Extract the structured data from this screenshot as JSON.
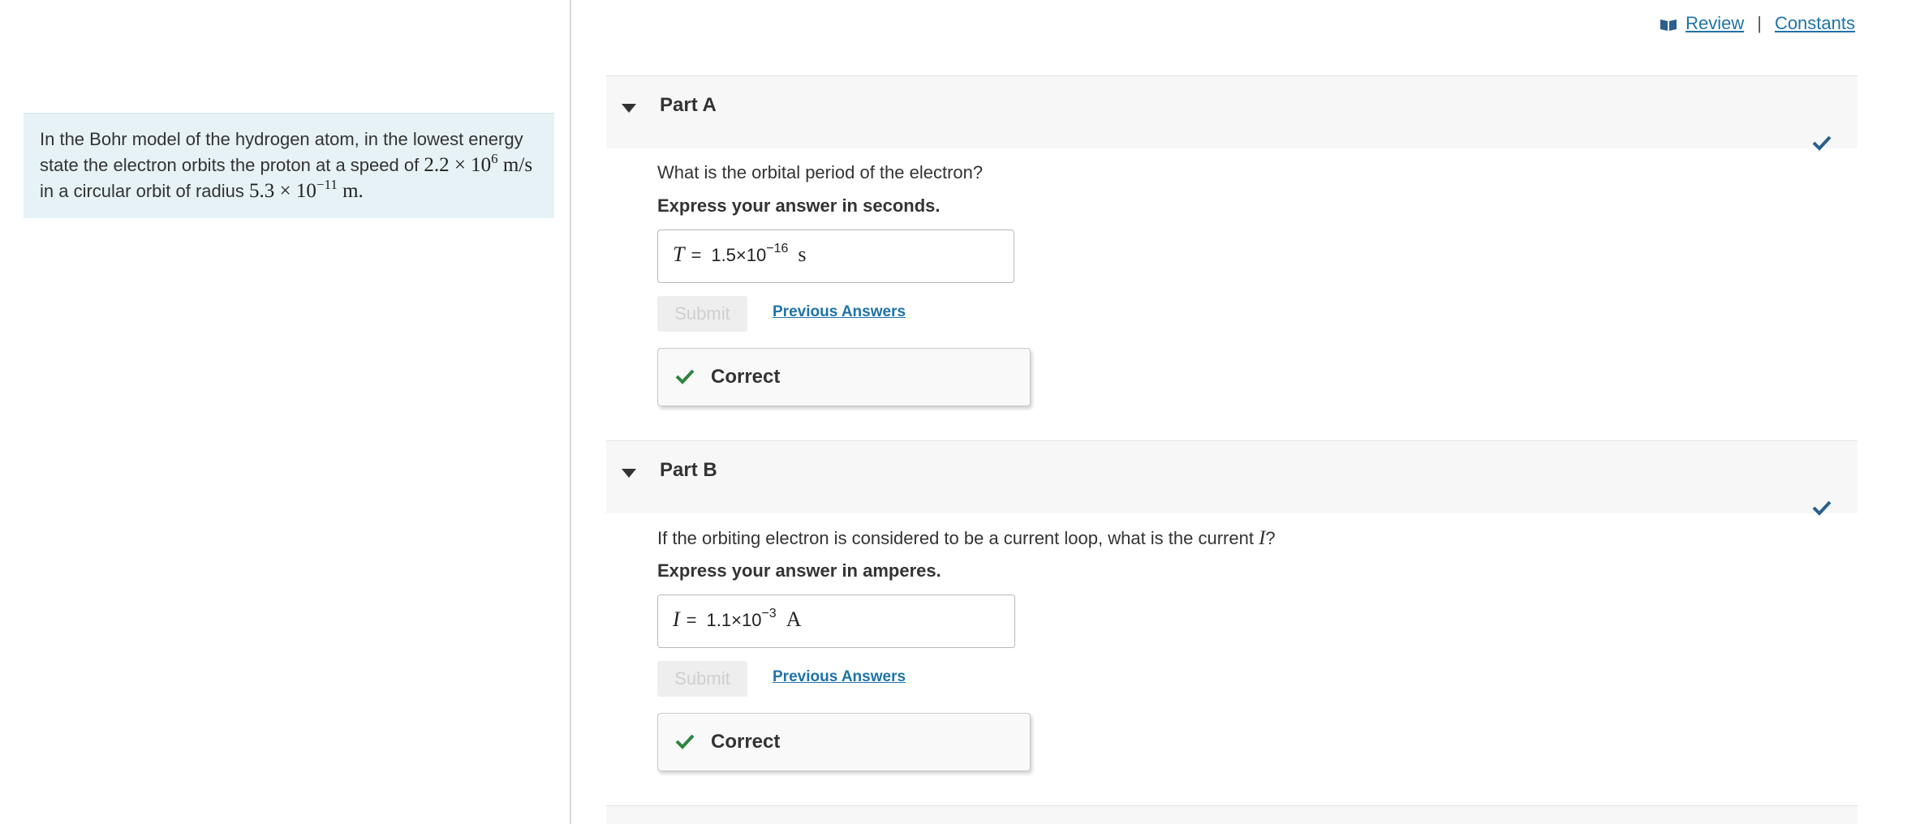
{
  "top_links": {
    "review": "Review",
    "separator": "|",
    "constants": "Constants",
    "accent_color": "#1f73a8"
  },
  "intro": {
    "text_1": "In the Bohr model of the hydrogen atom, in the lowest energy state the electron orbits the proton at a speed of ",
    "speed_mantissa": "2.2",
    "times": "×",
    "speed_base": "10",
    "speed_exp": "6",
    "speed_unit": "m/s",
    "text_2": " in a circular orbit of radius ",
    "radius_mantissa": "5.3",
    "radius_base": "10",
    "radius_exp": "−11",
    "radius_unit": "m",
    "period": "."
  },
  "parts": [
    {
      "title": "Part A",
      "question": "What is the orbital period of the electron?",
      "instruction": "Express your answer in seconds.",
      "variable": "T",
      "equals": "=",
      "answer_mantissa": "1.5×10",
      "answer_exp": "−16",
      "unit": "s",
      "submit_label": "Submit",
      "previous_answers_label": "Previous Answers",
      "result_label": "Correct",
      "status": "correct"
    },
    {
      "title": "Part B",
      "question_prefix": "If the orbiting electron is considered to be a current loop, what is the current ",
      "question_var": "I",
      "question_suffix": "?",
      "instruction": "Express your answer in amperes.",
      "variable": "I",
      "equals": "=",
      "answer_mantissa": "1.1×10",
      "answer_exp": "−3",
      "unit": "A",
      "submit_label": "Submit",
      "previous_answers_label": "Previous Answers",
      "result_label": "Correct",
      "status": "correct"
    }
  ],
  "colors": {
    "check_green": "#2e8540",
    "check_blue": "#2b5f8c",
    "intro_bg": "#e6f2f6"
  }
}
